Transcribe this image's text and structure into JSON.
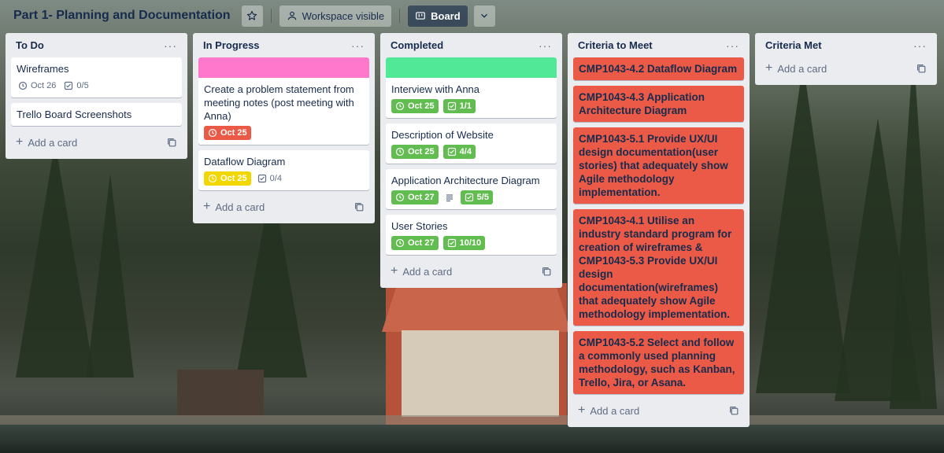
{
  "header": {
    "board_title": "Part 1- Planning and Documentation",
    "visibility_label": "Workspace visible",
    "view_label": "Board"
  },
  "add_card_label": "Add a card",
  "colors": {
    "green_label": "#61bd4f",
    "red_label": "#eb5a46",
    "yellow_label": "#f2d600",
    "pink_cover": "#ff78cb",
    "green_cover": "#51e898",
    "list_bg": "#ebecf0"
  },
  "lists": [
    {
      "title": "To Do",
      "cards": [
        {
          "title": "Wireframes",
          "due": "Oct 26",
          "checklist": "0/5"
        },
        {
          "title": "Trello Board Screenshots"
        }
      ]
    },
    {
      "title": "In Progress",
      "cards": [
        {
          "title": "Create a problem statement from meeting notes (post meeting with Anna)",
          "due": "Oct 25"
        },
        {
          "title": "Dataflow Diagram",
          "due": "Oct 25",
          "checklist": "0/4"
        }
      ]
    },
    {
      "title": "Completed",
      "cards": [
        {
          "title": "Interview with Anna",
          "due": "Oct 25",
          "checklist": "1/1"
        },
        {
          "title": "Description of Website",
          "due": "Oct 25",
          "checklist": "4/4"
        },
        {
          "title": "Application Architecture Diagram",
          "due": "Oct 27",
          "checklist": "5/5"
        },
        {
          "title": "User Stories",
          "due": "Oct 27",
          "checklist": "10/10"
        }
      ]
    },
    {
      "title": "Criteria to Meet",
      "cards": [
        {
          "title": "CMP1043-4.2 Dataflow Diagram"
        },
        {
          "title": "CMP1043-4.3 Application Architecture Diagram"
        },
        {
          "title": "CMP1043-5.1 Provide UX/UI design documentation(user stories) that adequately show Agile methodology implementation."
        },
        {
          "title": "CMP1043-4.1 Utilise an industry standard program for creation of wireframes & CMP1043-5.3 Provide UX/UI design documentation(wireframes) that adequately show Agile methodology implementation."
        },
        {
          "title": "CMP1043-5.2 Select and follow a commonly used planning methodology, such as Kanban, Trello, Jira, or Asana."
        }
      ]
    },
    {
      "title": "Criteria Met",
      "cards": []
    }
  ]
}
